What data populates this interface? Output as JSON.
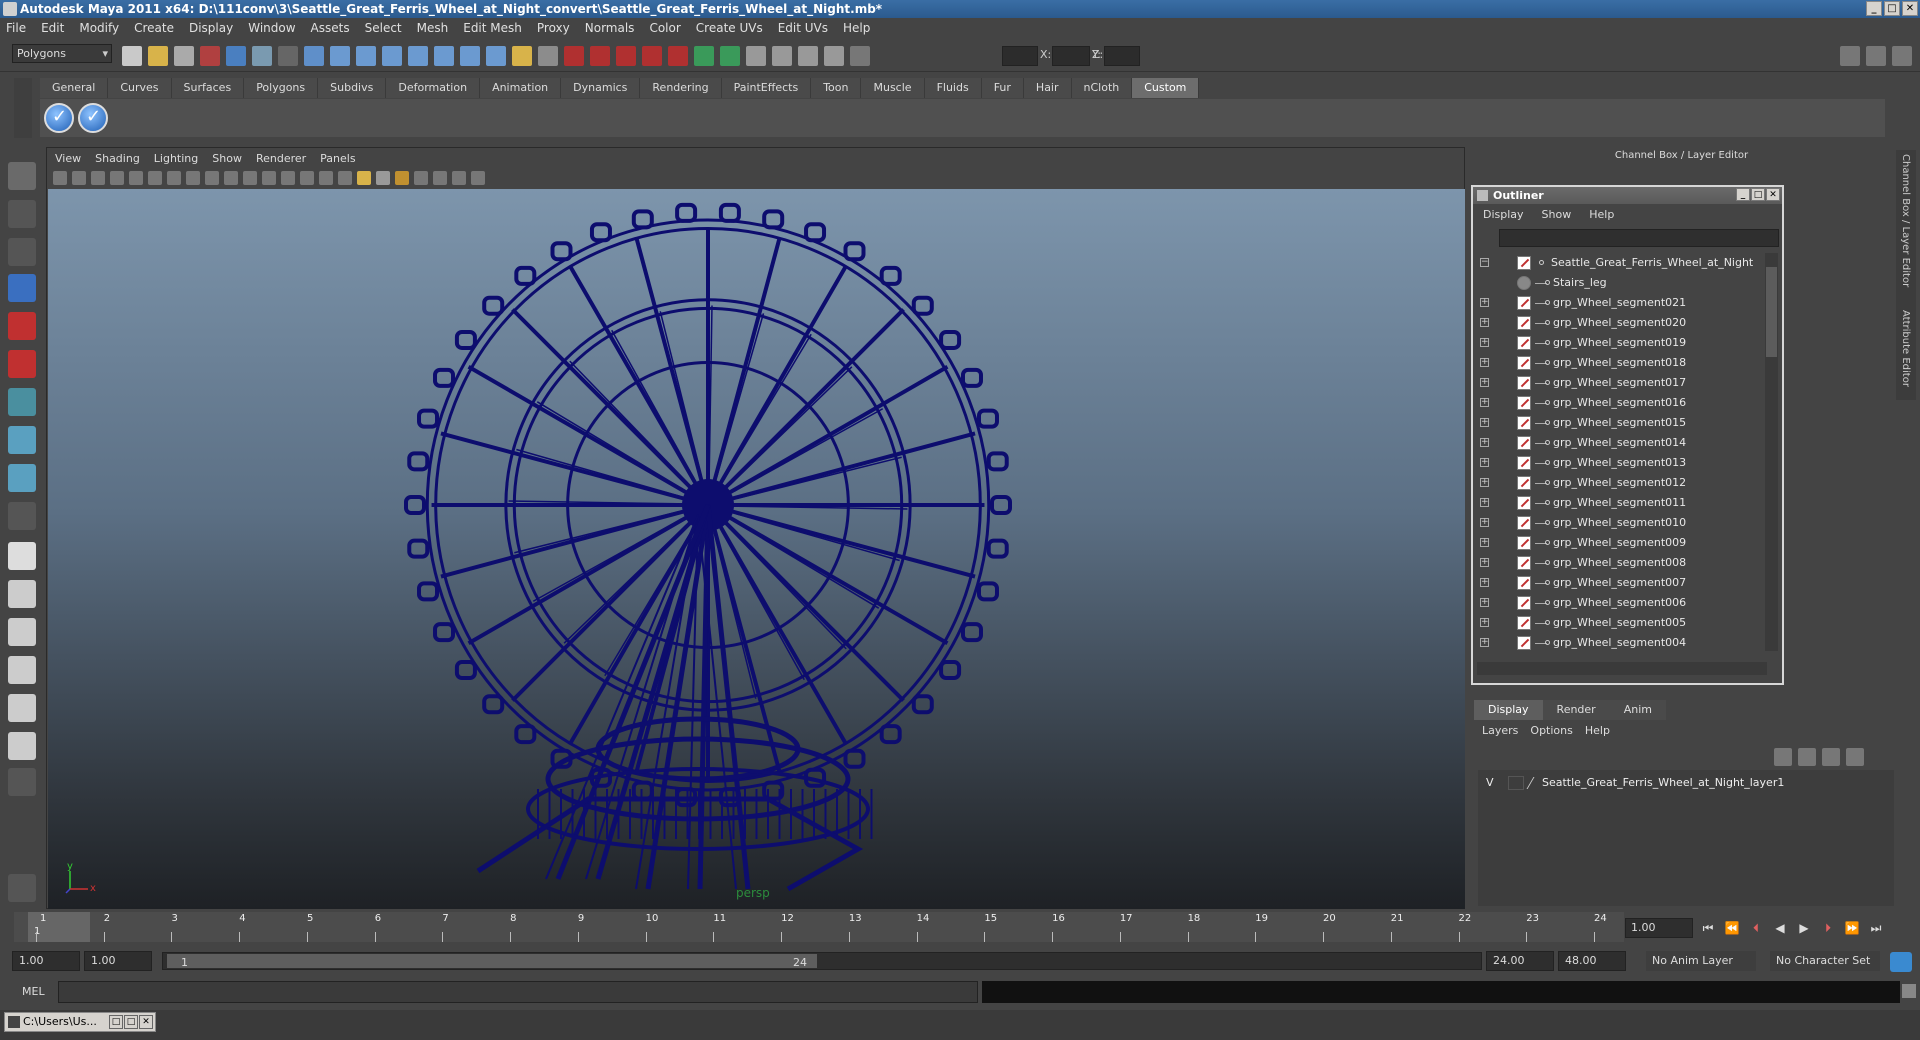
{
  "window": {
    "title": "Autodesk Maya 2011 x64: D:\\111conv\\3\\Seattle_Great_Ferris_Wheel_at_Night_convert\\Seattle_Great_Ferris_Wheel_at_Night.mb*",
    "minimize": "_",
    "maximize": "□",
    "close": "✕"
  },
  "menubar": [
    "File",
    "Edit",
    "Modify",
    "Create",
    "Display",
    "Window",
    "Assets",
    "Select",
    "Mesh",
    "Edit Mesh",
    "Proxy",
    "Normals",
    "Color",
    "Create UVs",
    "Edit UVs",
    "Help"
  ],
  "status": {
    "mode": "Polygons",
    "x_label": "X:",
    "y_label": "Y:",
    "z_label": "Z:"
  },
  "shelf": {
    "tabs": [
      "General",
      "Curves",
      "Surfaces",
      "Polygons",
      "Subdivs",
      "Deformation",
      "Animation",
      "Dynamics",
      "Rendering",
      "PaintEffects",
      "Toon",
      "Muscle",
      "Fluids",
      "Fur",
      "Hair",
      "nCloth",
      "Custom"
    ],
    "active_tab": "Custom"
  },
  "viewport": {
    "menu": [
      "View",
      "Shading",
      "Lighting",
      "Show",
      "Renderer",
      "Panels"
    ],
    "camera": "persp",
    "axis_x": "x",
    "axis_y": "y",
    "wire_color": "#0d0d6e"
  },
  "channel_box": {
    "header": "Channel Box / Layer Editor",
    "side_tabs": [
      "Channel Box / Layer Editor",
      "Attribute Editor"
    ]
  },
  "outliner": {
    "title": "Outliner",
    "menu": [
      "Display",
      "Show",
      "Help"
    ],
    "root": "Seattle_Great_Ferris_Wheel_at_Night",
    "items": [
      {
        "label": "Stairs_leg",
        "kind": "mesh",
        "expandable": false
      },
      {
        "label": "grp_Wheel_segment021",
        "kind": "group",
        "expandable": true
      },
      {
        "label": "grp_Wheel_segment020",
        "kind": "group",
        "expandable": true
      },
      {
        "label": "grp_Wheel_segment019",
        "kind": "group",
        "expandable": true
      },
      {
        "label": "grp_Wheel_segment018",
        "kind": "group",
        "expandable": true
      },
      {
        "label": "grp_Wheel_segment017",
        "kind": "group",
        "expandable": true
      },
      {
        "label": "grp_Wheel_segment016",
        "kind": "group",
        "expandable": true
      },
      {
        "label": "grp_Wheel_segment015",
        "kind": "group",
        "expandable": true
      },
      {
        "label": "grp_Wheel_segment014",
        "kind": "group",
        "expandable": true
      },
      {
        "label": "grp_Wheel_segment013",
        "kind": "group",
        "expandable": true
      },
      {
        "label": "grp_Wheel_segment012",
        "kind": "group",
        "expandable": true
      },
      {
        "label": "grp_Wheel_segment011",
        "kind": "group",
        "expandable": true
      },
      {
        "label": "grp_Wheel_segment010",
        "kind": "group",
        "expandable": true
      },
      {
        "label": "grp_Wheel_segment009",
        "kind": "group",
        "expandable": true
      },
      {
        "label": "grp_Wheel_segment008",
        "kind": "group",
        "expandable": true
      },
      {
        "label": "grp_Wheel_segment007",
        "kind": "group",
        "expandable": true
      },
      {
        "label": "grp_Wheel_segment006",
        "kind": "group",
        "expandable": true
      },
      {
        "label": "grp_Wheel_segment005",
        "kind": "group",
        "expandable": true
      },
      {
        "label": "grp_Wheel_segment004",
        "kind": "group",
        "expandable": true
      }
    ]
  },
  "layers": {
    "tabs": [
      "Display",
      "Render",
      "Anim"
    ],
    "active_tab": "Display",
    "menu": [
      "Layers",
      "Options",
      "Help"
    ],
    "rows": [
      {
        "visible": "V",
        "name": "Seattle_Great_Ferris_Wheel_at_Night_layer1"
      }
    ]
  },
  "timeline": {
    "ticks": [
      "1",
      "2",
      "3",
      "4",
      "5",
      "6",
      "7",
      "8",
      "9",
      "10",
      "11",
      "12",
      "13",
      "14",
      "15",
      "16",
      "17",
      "18",
      "19",
      "20",
      "21",
      "22",
      "23",
      "24"
    ],
    "current_frame": "1",
    "current_time": "1.00"
  },
  "range": {
    "start_time": "1.00",
    "playback_start": "1.00",
    "range_start_label": "1",
    "range_end_label": "24",
    "playback_end": "24.00",
    "end_time": "48.00",
    "anim_layer": "No Anim Layer",
    "character_set": "No Character Set"
  },
  "command_line": {
    "label": "MEL"
  },
  "taskbar": {
    "item": "C:\\Users\\Us..."
  }
}
